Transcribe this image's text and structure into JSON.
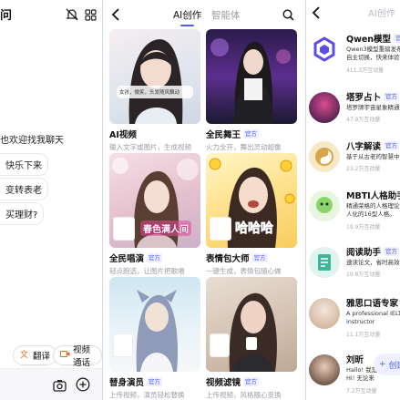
{
  "left_panel": {
    "title": "问",
    "bubbles": [
      "快乐下来",
      "变转表老",
      "买理财?"
    ],
    "greeting": "也欢迎找我聊天",
    "chips": [
      {
        "label": "翻译",
        "icon": "translate-icon"
      },
      {
        "label": "视频通话",
        "icon": "video-call-icon"
      }
    ]
  },
  "mid_panel": {
    "tabs": [
      "AI创作",
      "智能体"
    ],
    "cards": [
      {
        "name": "AI视频",
        "badge": "",
        "desc": "输入文字或图片，生成视频",
        "overlay": "女孩，微笑，头发随风飘动"
      },
      {
        "name": "全民舞王",
        "badge": "官方",
        "desc": "火力全开，舞出灵动超像",
        "overlay": ""
      },
      {
        "name": "全民唱演",
        "badge": "官方",
        "desc": "轻点跑选，让图片把歌唱",
        "overlay": "春色满人间"
      },
      {
        "name": "表情包大师",
        "badge": "官方",
        "desc": "一键生成，表情包随心做",
        "overlay": "哈哈哈"
      },
      {
        "name": "替身演员",
        "badge": "官方",
        "desc": "上传视频，演员轻松替换",
        "overlay": ""
      },
      {
        "name": "视频滤镜",
        "badge": "官方",
        "desc": "上传视频，风格随心变换",
        "overlay": ""
      }
    ]
  },
  "right_panel": {
    "tab": "AI创作",
    "items": [
      {
        "name": "Qwen模型",
        "badge": "官方",
        "desc": [
          "Qwen3模型重磅发布",
          "自主切换，快来体验"
        ],
        "stat": "411.3万互动量"
      },
      {
        "name": "塔罗占卜",
        "badge": "官方",
        "desc": [
          "塔罗牌宇宙星象精通"
        ],
        "stat": "47.9万互动量"
      },
      {
        "name": "八字解读",
        "badge": "官方",
        "desc": [
          "基于从古老的智慧中"
        ],
        "stat": "23.2万互动量"
      },
      {
        "name": "MBTI人格助手",
        "badge": "",
        "desc": [
          "精通荣格的人格理论",
          "人化的16型人格。"
        ],
        "stat": "19.9万互动量"
      },
      {
        "name": "阅读助手",
        "badge": "官方",
        "desc": [
          "速读论文，省时高效"
        ],
        "stat": "19.8万互动量"
      },
      {
        "name": "雅思口语专家",
        "badge": "",
        "desc": [
          "A professional IELTS",
          "instructor"
        ],
        "stat": "11.1万互动量"
      },
      {
        "name": "刘昕",
        "badge": "",
        "desc": [
          "Hallo! 我是刘",
          "Hi! 无论来"
        ],
        "stat": "7.2万互动量"
      }
    ],
    "create_label": "创建"
  }
}
